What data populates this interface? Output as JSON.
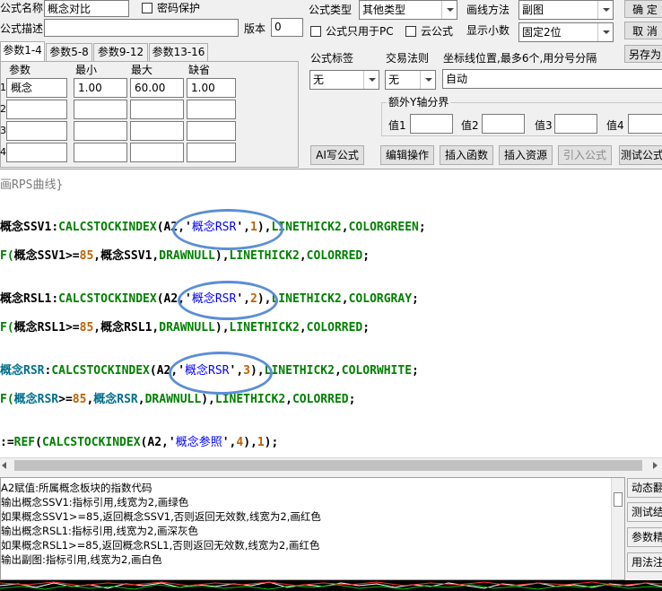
{
  "header": {
    "name_label": "公式名称",
    "name_value": "概念对比",
    "password_label": "密码保护",
    "desc_label": "公式描述",
    "desc_value": "",
    "version_label": "版本",
    "version_value": "0",
    "type_label": "公式类型",
    "type_value": "其他类型",
    "draw_label": "画线方法",
    "draw_value": "副图",
    "pc_only_label": "公式只用于PC",
    "cloud_label": "云公式",
    "decimals_label": "显示小数",
    "decimals_value": "固定2位",
    "tag_label": "公式标签",
    "tag_value": "无",
    "trade_label": "交易法则",
    "trade_value": "无",
    "coord_label": "坐标线位置,最多6个,用分号分隔",
    "coord_value": "自动",
    "extra_y_label": "额外Y轴分界",
    "val1_label": "值1",
    "val2_label": "值2",
    "val3_label": "值3",
    "val4_label": "值4"
  },
  "buttons": {
    "ok": "确  定",
    "cancel": "取  消",
    "save_as": "另存为",
    "ai_formula": "AI写公式",
    "edit_op": "编辑操作",
    "insert_func": "插入函数",
    "insert_res": "插入资源",
    "import_formula": "引入公式",
    "test_formula": "测试公式"
  },
  "tabs": [
    "参数1-4",
    "参数5-8",
    "参数9-12",
    "参数13-16"
  ],
  "params": {
    "headers": [
      "参数",
      "最小",
      "最大",
      "缺省"
    ],
    "rows": [
      {
        "num": "1",
        "name": "概念",
        "min": "1.00",
        "max": "60.00",
        "def": "1.00"
      },
      {
        "num": "2",
        "name": "",
        "min": "",
        "max": "",
        "def": ""
      },
      {
        "num": "3",
        "name": "",
        "min": "",
        "max": "",
        "def": ""
      },
      {
        "num": "4",
        "name": "",
        "min": "",
        "max": "",
        "def": ""
      }
    ]
  },
  "code": {
    "comment": "画RPS曲线}",
    "l1": [
      "概念SSV1",
      ":",
      "CALCSTOCKINDEX",
      "(A2,'",
      "概念RSR",
      "',",
      "1",
      "),",
      "LINETHICK2",
      ",",
      "COLORGREEN",
      ";"
    ],
    "l2": [
      "F(",
      "概念SSV1",
      ">=",
      "85",
      ",",
      "概念SSV1",
      ",",
      "DRAWNULL",
      "),",
      "LINETHICK2",
      ",",
      "COLORRED",
      ";"
    ],
    "l3": [
      "概念RSL1",
      ":",
      "CALCSTOCKINDEX",
      "(A2,'",
      "概念RSR",
      "',",
      "2",
      "),",
      "LINETHICK2",
      ",",
      "COLORGRAY",
      ";"
    ],
    "l4": [
      "F(",
      "概念RSL1",
      ">=",
      "85",
      ",",
      "概念RSL1",
      ",",
      "DRAWNULL",
      "),",
      "LINETHICK2",
      ",",
      "COLORRED",
      ";"
    ],
    "l5": [
      "概念RSR",
      ":",
      "CALCSTOCKINDEX",
      "(A2,'",
      "概念RSR",
      "',",
      "3",
      "),",
      "LINETHICK2",
      ",",
      "COLORWHITE",
      ";"
    ],
    "l6": [
      "F(",
      "概念RSR",
      ">=",
      "85",
      ",",
      "概念RSR",
      ",",
      "DRAWNULL",
      "),",
      "LINETHICK2",
      ",",
      "COLORRED",
      ";"
    ],
    "l7": [
      ":=",
      "REF",
      "(",
      "CALCSTOCKINDEX",
      "(A2,'",
      "概念参照",
      "',",
      "4",
      "),",
      "1",
      ");"
    ]
  },
  "description": [
    "A2赋值:所属概念板块的指数代码",
    "输出概念SSV1:指标引用,线宽为2,画绿色",
    "如果概念SSV1>=85,返回概念SSV1,否则返回无效数,线宽为2,画红色",
    "输出概念RSL1:指标引用,线宽为2,画深灰色",
    "如果概念RSL1>=85,返回概念RSL1,否则返回无效数,线宽为2,画红色",
    "输出副图:指标引用,线宽为2,画白色"
  ],
  "side_buttons": [
    "动态翻",
    "测试结",
    "参数精",
    "用法注"
  ],
  "colors": {
    "annotation_ellipse": "#5b8ed6",
    "keyword_blue": "#0000ff",
    "color_green": "#008000",
    "number_orange": "#c06000"
  }
}
